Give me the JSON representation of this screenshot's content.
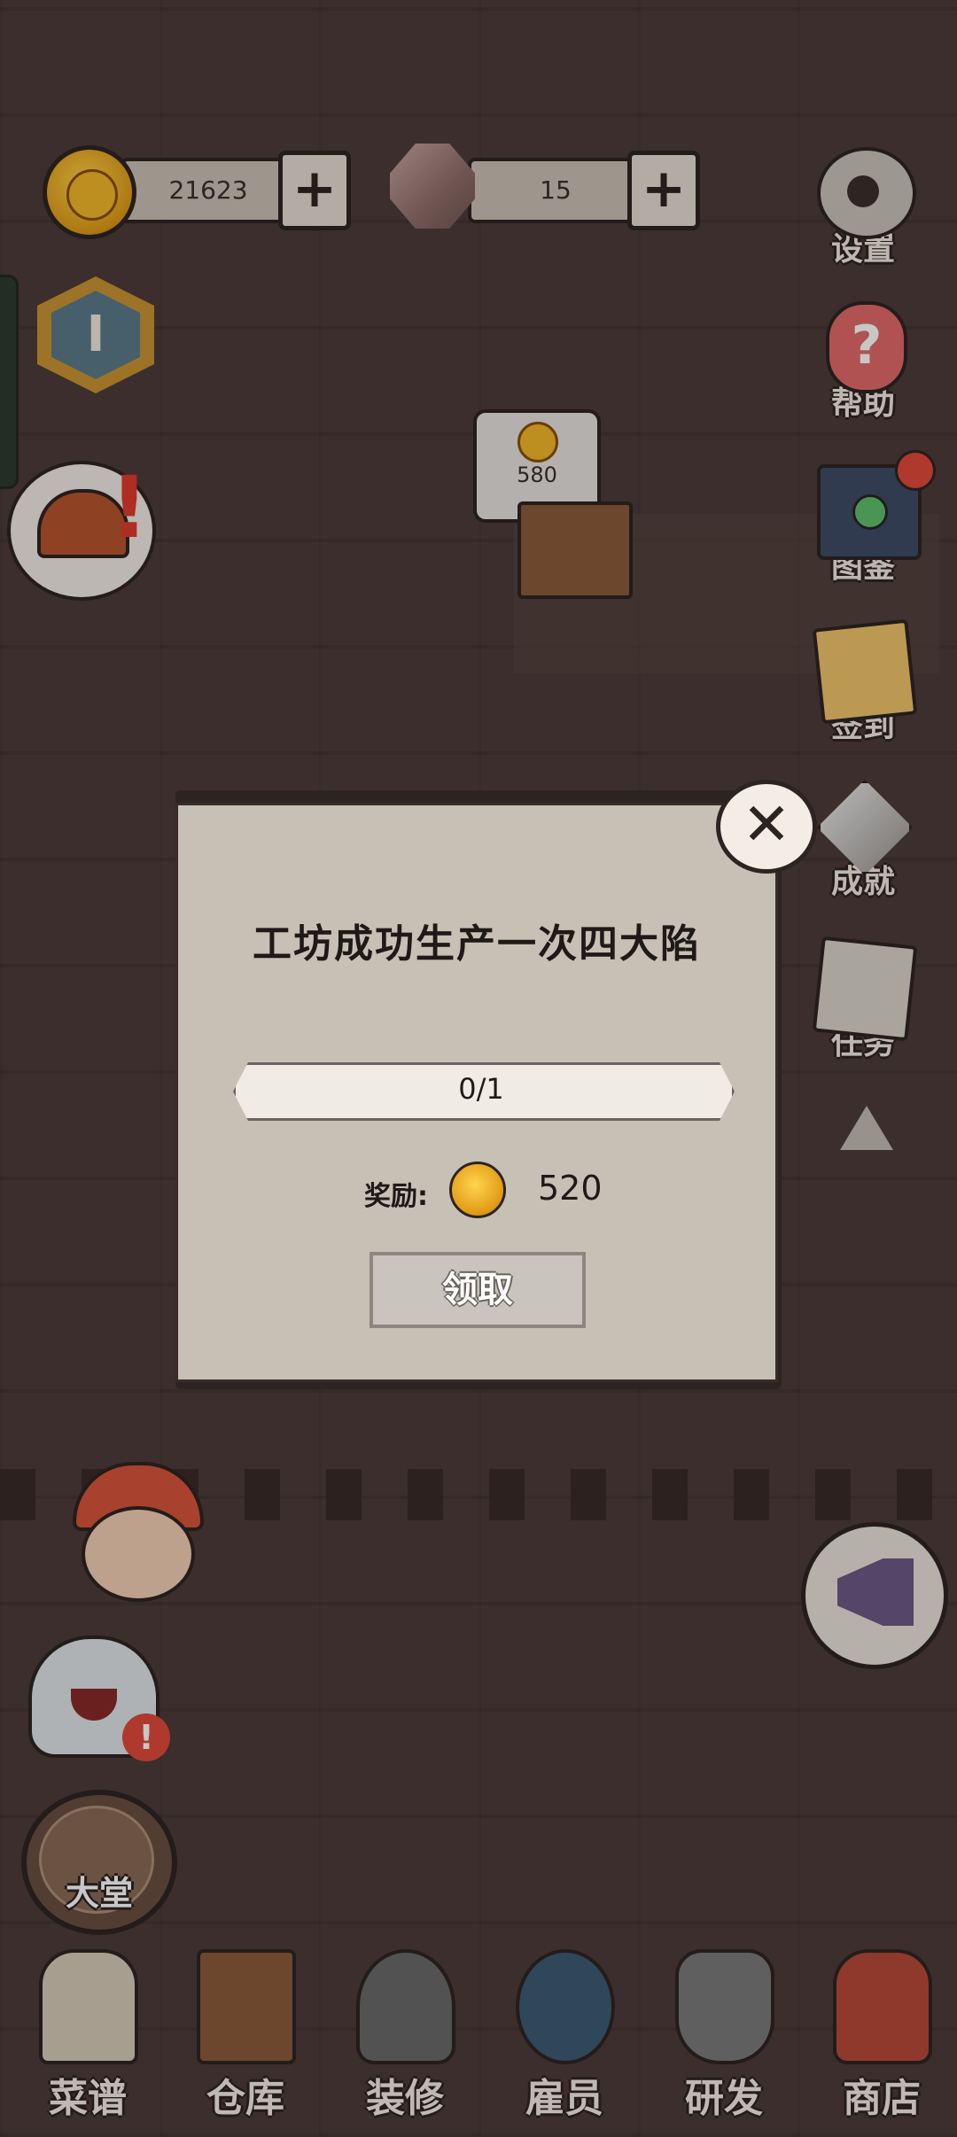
{
  "currency": {
    "coins": "21623",
    "gems": "15",
    "coin_plus": "+",
    "gem_plus": "+"
  },
  "level": "I",
  "scene": {
    "coin_bubble_value": "580"
  },
  "right_menu": [
    {
      "id": "settings",
      "label": "设置",
      "icon": "gear-icon"
    },
    {
      "id": "help",
      "label": "帮助",
      "icon": "question-icon",
      "glyph": "?"
    },
    {
      "id": "codex",
      "label": "图鉴",
      "icon": "book-icon"
    },
    {
      "id": "checkin",
      "label": "签到",
      "icon": "scroll-icon"
    },
    {
      "id": "achievements",
      "label": "成就",
      "icon": "diamond-icon"
    },
    {
      "id": "tasks",
      "label": "任务",
      "icon": "map-icon"
    }
  ],
  "modal": {
    "title": "工坊成功生产一次四大陷",
    "progress_text": "0/1",
    "progress_value": 0,
    "reward_label": "奖励:",
    "reward_value": "520",
    "claim_label": "领取",
    "close_glyph": "✕"
  },
  "left": {
    "alert_glyph": "!",
    "hall_label": "大堂"
  },
  "bottom_nav": [
    {
      "id": "recipes",
      "label": "菜谱",
      "icon": "scroll-icon",
      "color": "#d8cbb8"
    },
    {
      "id": "storage",
      "label": "仓库",
      "icon": "cabinet-icon",
      "color": "#8b5c3c"
    },
    {
      "id": "decorate",
      "label": "装修",
      "icon": "hammer-icon",
      "color": "#6a6a6a"
    },
    {
      "id": "staff",
      "label": "雇员",
      "icon": "staff-icon",
      "color": "#3e5a72"
    },
    {
      "id": "research",
      "label": "研发",
      "icon": "pot-icon",
      "color": "#7a7a7a"
    },
    {
      "id": "shop",
      "label": "商店",
      "icon": "shop-bag-icon",
      "color": "#b84a3a"
    }
  ],
  "colors": {
    "accent_gold": "#f2b72a",
    "progress_fill": "#9cc46a",
    "alert_red": "#e04a3a"
  }
}
